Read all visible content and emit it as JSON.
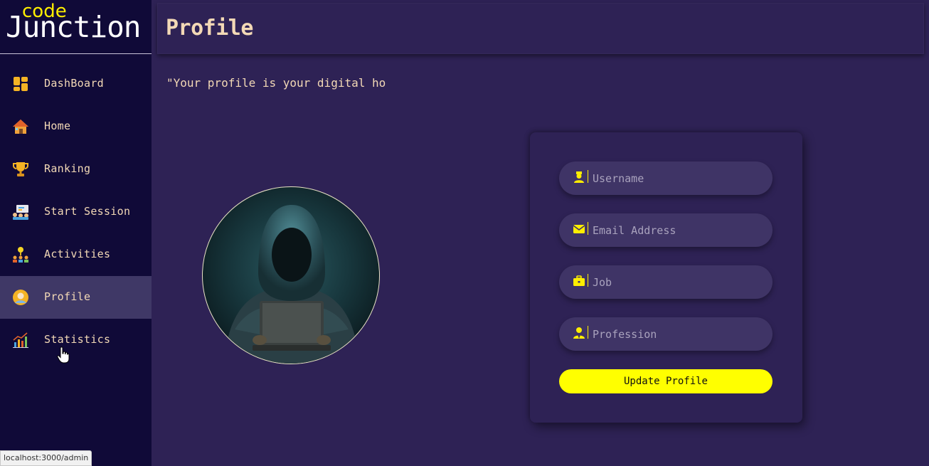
{
  "logo": {
    "small": "code",
    "big": "Junction"
  },
  "nav": {
    "items": [
      {
        "label": "DashBoard",
        "icon": "dashboard-icon"
      },
      {
        "label": "Home",
        "icon": "house-icon"
      },
      {
        "label": "Ranking",
        "icon": "trophy-icon"
      },
      {
        "label": "Start Session",
        "icon": "session-icon"
      },
      {
        "label": "Activities",
        "icon": "activities-icon"
      },
      {
        "label": "Profile",
        "icon": "profile-icon",
        "active": true
      },
      {
        "label": "Statistics",
        "icon": "chart-icon"
      }
    ]
  },
  "header": {
    "title": "Profile"
  },
  "main": {
    "quote": "\"Your profile is your digital ho"
  },
  "form": {
    "username_placeholder": "Username",
    "email_placeholder": "Email Address",
    "job_placeholder": "Job",
    "profession_placeholder": "Profession",
    "submit_label": "Update Profile"
  },
  "status_bar": {
    "url": "localhost:3000/admin"
  },
  "colors": {
    "sidebar_bg": "#100a38",
    "main_bg": "#2e2255",
    "accent": "#ffff00",
    "text": "#f3d9b6"
  }
}
